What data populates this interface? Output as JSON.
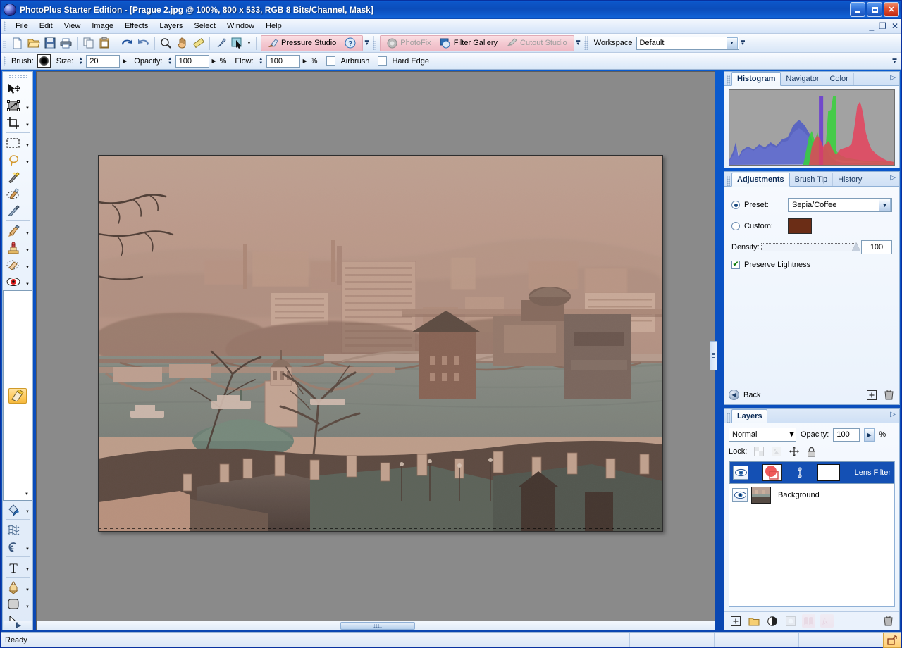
{
  "window": {
    "title": "PhotoPlus Starter Edition - [Prague 2.jpg @ 100%, 800 x 533, RGB 8 Bits/Channel, Mask]",
    "app_icon": "photoplus-orb-icon",
    "minimize": "minimize-icon",
    "maximize": "maximize-icon",
    "close": "close-icon"
  },
  "menu": {
    "items": [
      "File",
      "Edit",
      "View",
      "Image",
      "Effects",
      "Layers",
      "Select",
      "Window",
      "Help"
    ],
    "mdi": [
      "minimize-document",
      "restore-document",
      "close-document"
    ]
  },
  "toolbar": {
    "buttons": [
      {
        "name": "new-icon",
        "label": "New"
      },
      {
        "name": "open-icon",
        "label": "Open"
      },
      {
        "name": "save-icon",
        "label": "Save"
      },
      {
        "name": "print-icon",
        "label": "Print"
      },
      {
        "name": "copy-icon",
        "label": "Copy"
      },
      {
        "name": "paste-icon",
        "label": "Paste"
      },
      {
        "name": "undo-icon",
        "label": "Undo"
      },
      {
        "name": "redo-icon",
        "label": "Redo"
      },
      {
        "name": "zoom-icon",
        "label": "Zoom Tool"
      },
      {
        "name": "pan-hand-icon",
        "label": "Pan Tool"
      },
      {
        "name": "measure-icon",
        "label": "Measure"
      },
      {
        "name": "node-edit-icon",
        "label": "Node Edit"
      },
      {
        "name": "pointer-select-icon",
        "label": "Select"
      }
    ],
    "pressure_studio": "Pressure Studio",
    "help_icon": "help-question-icon",
    "studios": [
      {
        "label": "PhotoFix",
        "icon": "photofix-icon",
        "disabled": true
      },
      {
        "label": "Filter Gallery",
        "icon": "filter-gallery-icon",
        "disabled": false
      },
      {
        "label": "Cutout Studio",
        "icon": "cutout-studio-icon",
        "disabled": true
      }
    ],
    "workspace_label": "Workspace",
    "workspace_value": "Default"
  },
  "options_bar": {
    "brush_label": "Brush:",
    "brush_swatch": "brush-tip-swatch",
    "size_label": "Size:",
    "size_value": "20",
    "opacity_label": "Opacity:",
    "opacity_value": "100",
    "opacity_unit": "%",
    "flow_label": "Flow:",
    "flow_value": "100",
    "flow_unit": "%",
    "airbrush_label": "Airbrush",
    "airbrush_checked": false,
    "hard_edge_label": "Hard Edge",
    "hard_edge_checked": false
  },
  "tools": [
    {
      "name": "move-tool",
      "glyph": "pointer-move-icon",
      "flyout": false,
      "selected": false
    },
    {
      "name": "deform-tool",
      "glyph": "deform-mesh-icon",
      "flyout": true,
      "selected": false
    },
    {
      "name": "crop-tool",
      "glyph": "crop-icon",
      "flyout": true,
      "selected": false
    },
    {
      "name": "rectangle-select-tool",
      "glyph": "marquee-rect-icon",
      "flyout": true,
      "selected": false
    },
    {
      "name": "lasso-select-tool",
      "glyph": "lasso-icon",
      "flyout": true,
      "selected": false
    },
    {
      "name": "magic-wand-tool",
      "glyph": "magic-wand-icon",
      "flyout": false,
      "selected": false
    },
    {
      "name": "selection-brush-tool",
      "glyph": "selection-brush-icon",
      "flyout": false,
      "selected": false
    },
    {
      "name": "color-picker-tool",
      "glyph": "eyedropper-icon",
      "flyout": false,
      "selected": false
    },
    {
      "name": "paintbrush-tool",
      "glyph": "paintbrush-icon",
      "flyout": true,
      "selected": false
    },
    {
      "name": "clone-tool",
      "glyph": "clone-stamp-icon",
      "flyout": true,
      "selected": false
    },
    {
      "name": "retouch-tool",
      "glyph": "eraser-retouch-icon",
      "flyout": true,
      "selected": false
    },
    {
      "name": "red-eye-tool",
      "glyph": "red-eye-icon",
      "flyout": true,
      "selected": false
    },
    {
      "name": "eraser-tool",
      "glyph": "eraser-icon",
      "flyout": true,
      "selected": true
    },
    {
      "name": "flood-fill-tool",
      "glyph": "paint-bucket-icon",
      "flyout": true,
      "selected": false
    },
    {
      "name": "mesh-warp-tool",
      "glyph": "mesh-warp-icon",
      "flyout": false,
      "selected": false
    },
    {
      "name": "smudge-tool",
      "glyph": "smudge-swirl-icon",
      "flyout": true,
      "selected": false
    },
    {
      "name": "text-tool",
      "glyph": "text-t-icon",
      "flyout": true,
      "selected": false
    },
    {
      "name": "pen-tool",
      "glyph": "pen-nib-icon",
      "flyout": true,
      "selected": false
    },
    {
      "name": "shape-tool",
      "glyph": "rounded-rect-icon",
      "flyout": true,
      "selected": false
    },
    {
      "name": "node-tool",
      "glyph": "node-pointer-icon",
      "flyout": true,
      "selected": false
    }
  ],
  "document": {
    "title": "Prague 2.jpg",
    "zoom": "100%",
    "dimensions": "800 x 533",
    "mode": "RGB 8 Bits/Channel",
    "mask": "Mask",
    "scroll_thumb": "horizontal-scroll-thumb"
  },
  "histogram_panel": {
    "tabs": [
      {
        "label": "Histogram",
        "active": true
      },
      {
        "label": "Navigator",
        "active": false
      },
      {
        "label": "Color",
        "active": false
      }
    ],
    "menu_arrow": "panel-menu-arrow-icon"
  },
  "adjustments_panel": {
    "tabs": [
      {
        "label": "Adjustments",
        "active": true
      },
      {
        "label": "Brush Tip",
        "active": false
      },
      {
        "label": "History",
        "active": false
      }
    ],
    "menu_arrow": "panel-menu-arrow-icon",
    "preset_label": "Preset:",
    "preset_value": "Sepia/Coffee",
    "preset_selected": true,
    "custom_label": "Custom:",
    "custom_selected": false,
    "custom_color": "#6b2d16",
    "density_label": "Density:",
    "density_value": "100",
    "preserve_lightness_label": "Preserve Lightness",
    "preserve_lightness_checked": true,
    "back_label": "Back",
    "footer_icons": [
      "add-adjustment-icon",
      "delete-adjustment-icon"
    ]
  },
  "layers_panel": {
    "tabs": [
      {
        "label": "Layers",
        "active": true
      }
    ],
    "menu_arrow": "panel-menu-arrow-icon",
    "blend_mode": "Normal",
    "opacity_label": "Opacity:",
    "opacity_value": "100",
    "opacity_unit": "%",
    "lock_label": "Lock:",
    "lock_icons": [
      "lock-transparency-icon",
      "lock-pixels-icon",
      "lock-position-icon",
      "lock-all-icon"
    ],
    "layers": [
      {
        "name": "Lens Filter",
        "visible": true,
        "selected": true,
        "has_mask": true,
        "thumb": "lens-filter-thumb"
      },
      {
        "name": "Background",
        "visible": true,
        "selected": false,
        "has_mask": false,
        "thumb": "prague-photo-thumb"
      }
    ],
    "footer_icons": [
      {
        "name": "add-layer-icon",
        "dim": false
      },
      {
        "name": "add-layer-group-icon",
        "dim": false
      },
      {
        "name": "add-adjustment-layer-icon",
        "dim": false
      },
      {
        "name": "add-mask-icon",
        "dim": true
      },
      {
        "name": "layer-effects-icon",
        "dim": true
      },
      {
        "name": "fx-icon",
        "dim": true
      },
      {
        "name": "delete-layer-icon",
        "dim": false
      }
    ]
  },
  "statusbar": {
    "message": "Ready",
    "resize_grip": "resize-grip-icon"
  },
  "colors": {
    "title_blue": "#0b4dbb",
    "panel_bg": "#eaf2fc",
    "selection_blue": "#1450b4",
    "studio_pink": "#f4c9d1",
    "canvas_gray": "#8a8a8a",
    "sepia": "#6b2d16"
  }
}
